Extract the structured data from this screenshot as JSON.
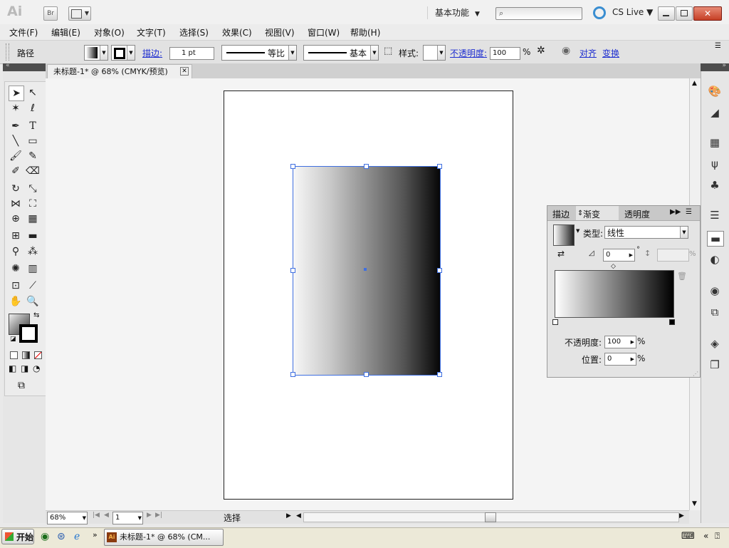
{
  "titlebar": {
    "app_logo": "Ai",
    "bridge_label": "Br",
    "workspace": "基本功能",
    "cs_live": "CS Live",
    "close_symbol": "✕"
  },
  "menu": {
    "items": [
      "文件(F)",
      "编辑(E)",
      "对象(O)",
      "文字(T)",
      "选择(S)",
      "效果(C)",
      "视图(V)",
      "窗口(W)",
      "帮助(H)"
    ]
  },
  "control": {
    "path_label": "路径",
    "stroke_link": "描边:",
    "stroke_weight": "1 pt",
    "profile_label": "等比",
    "brush_label": "基本",
    "style_label": "样式:",
    "opacity_link": "不透明度:",
    "opacity_value": "100",
    "percent": "%",
    "align_link": "对齐",
    "transform_link": "变换"
  },
  "document": {
    "tab_title": "未标题-1* @ 68% (CMYK/预览)",
    "zoom": "68%",
    "page": "1",
    "status": "选择"
  },
  "gradient_panel": {
    "tabs": [
      "描边",
      "渐变",
      "透明度"
    ],
    "active_tab": "渐变",
    "type_label": "类型:",
    "type_value": "线性",
    "angle_value": "0",
    "degree_symbol": "°",
    "aspect_percent": "%",
    "opacity_label": "不透明度:",
    "opacity_value": "100",
    "opacity_unit": "%",
    "position_label": "位置:",
    "position_value": "0",
    "position_unit": "%"
  },
  "taskbar": {
    "start_label": "开始",
    "task_label": "未标题-1* @ 68% (CM..."
  }
}
